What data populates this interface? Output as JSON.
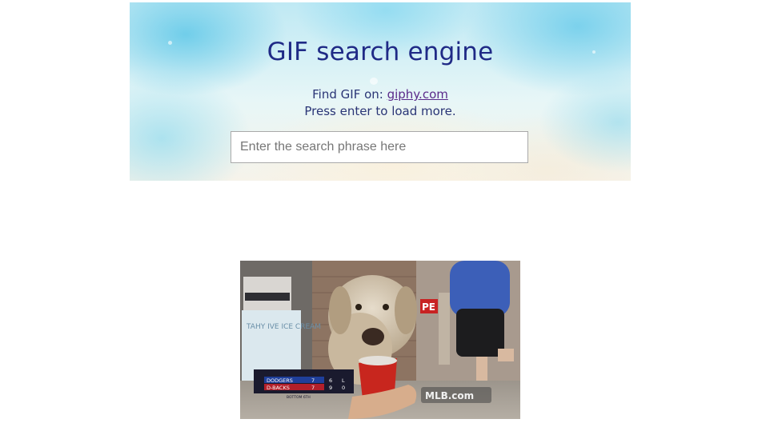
{
  "header": {
    "title": "GIF search engine",
    "find_prefix": "Find GIF on: ",
    "find_link": "giphy.com",
    "press_text": "Press enter to load more."
  },
  "search": {
    "placeholder": "Enter the search phrase here",
    "value": ""
  },
  "results": [
    {
      "scorebug": {
        "team1": "DODGERS",
        "team1_score": "7",
        "team1_h": "6",
        "team1_e": "L",
        "team2": "D-BACKS",
        "team2_score": "7",
        "team2_h": "9",
        "team2_e": "0",
        "inning": "BOTTOM 6TH"
      },
      "watermark": "MLB.com",
      "store_sign": "PE",
      "poster_text": "TAHY IVE ICE CREAM"
    }
  ],
  "colors": {
    "title": "#1f2a86",
    "text": "#2a3576",
    "link": "#5a2a8a"
  }
}
